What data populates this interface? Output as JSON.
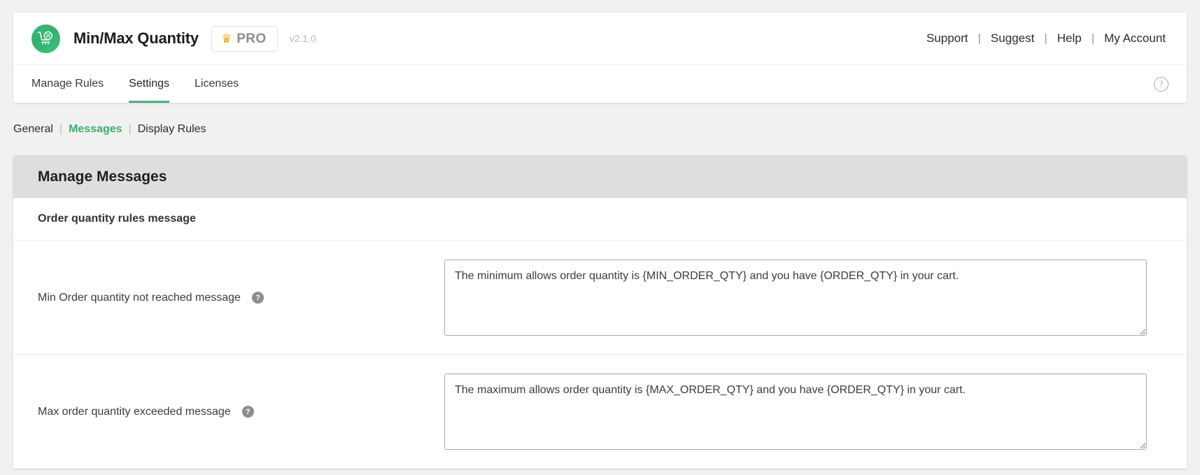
{
  "header": {
    "logo_icon": "cart-percent-icon",
    "app_title": "Min/Max Quantity",
    "pro_badge": {
      "crown_icon": "crown-icon",
      "label": "PRO"
    },
    "version": "v2.1.0",
    "links": [
      {
        "label": "Support"
      },
      {
        "label": "Suggest"
      },
      {
        "label": "Help"
      },
      {
        "label": "My Account"
      }
    ],
    "separator": "|"
  },
  "tabs": [
    {
      "label": "Manage Rules",
      "active": false
    },
    {
      "label": "Settings",
      "active": true
    },
    {
      "label": "Licenses",
      "active": false
    }
  ],
  "tab_help_icon": "question-circle-icon",
  "tab_help_glyph": "?",
  "subnav": {
    "separator": "|",
    "items": [
      {
        "label": "General",
        "current": false
      },
      {
        "label": "Messages",
        "current": true
      },
      {
        "label": "Display Rules",
        "current": false
      }
    ]
  },
  "panel": {
    "title": "Manage Messages",
    "section_title": "Order quantity rules message",
    "help_glyph": "?",
    "fields": [
      {
        "label": "Min Order quantity not reached message",
        "help_icon": "help-circle-icon",
        "value": "The minimum allows order quantity is {MIN_ORDER_QTY} and you have {ORDER_QTY} in your cart.",
        "placeholder": ""
      },
      {
        "label": "Max order quantity exceeded message",
        "help_icon": "help-circle-icon",
        "value": "The maximum allows order quantity is {MAX_ORDER_QTY} and you have {ORDER_QTY} in your cart.",
        "placeholder": ""
      }
    ]
  },
  "colors": {
    "brand_green": "#3cb878",
    "active_tab_underline": "#4caf7d",
    "pro_gold": "#f5a623",
    "panel_head_bg": "#dedede",
    "page_bg": "#f1f1f1"
  }
}
